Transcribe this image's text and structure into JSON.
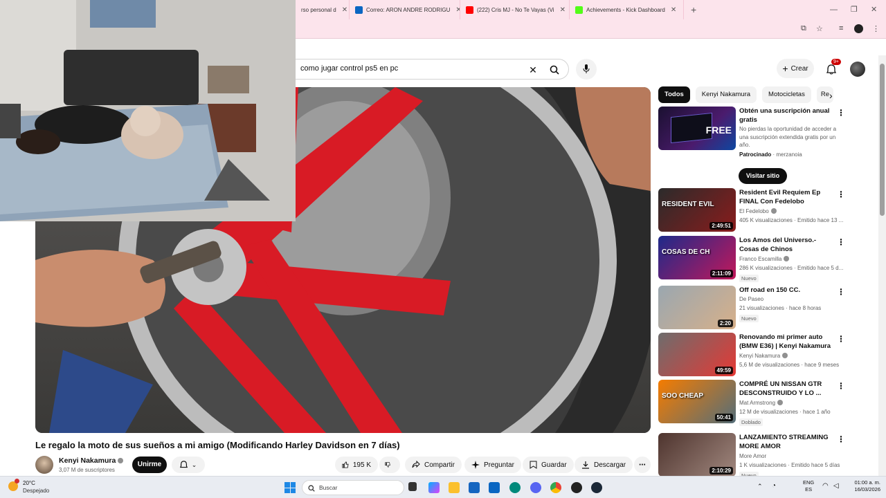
{
  "browser": {
    "tabs": [
      {
        "label": "rso personal d",
        "color": "#9e9e9e"
      },
      {
        "label": "Correo: ARON ANDRE RODRIGU",
        "color": "#0a66c2"
      },
      {
        "label": "(222) Cris MJ - No Te Vayas (Vi",
        "color": "#ff0000"
      },
      {
        "label": "Achievements - Kick Dashboard",
        "color": "#53fc18"
      }
    ]
  },
  "header": {
    "search_query": "como jugar control ps5 en pc",
    "create_label": "Crear",
    "notifications_count": "9+"
  },
  "video": {
    "title": "Le regalo la moto de sus sueños a mi amigo (Modificando Harley Davidson en 7 días)",
    "channel": "Kenyi Nakamura",
    "subscribers": "3,07 M de suscriptores",
    "join_label": "Unirme",
    "likes": "195 K",
    "share_label": "Compartir",
    "ask_label": "Preguntar",
    "save_label": "Guardar",
    "download_label": "Descargar"
  },
  "chips": [
    "Todos",
    "Kenyi Nakamura",
    "Motocicletas",
    "Re"
  ],
  "ad": {
    "title": "Obtén una suscripción anual gratis",
    "description": "No pierdas la oportunidad de acceder a una suscripción extendida gratis por un año.",
    "sponsored": "Patrocinado",
    "advertiser": "merzanoia",
    "cta": "Visitar sitio",
    "thumb_free": "FREE"
  },
  "recommendations": [
    {
      "title": "Resident Evil Requiem Ep FINAL Con Fedelobo",
      "channel": "El Fedelobo",
      "verified": true,
      "meta": "405 K visualizaciones · Emitido hace 13 ...",
      "duration": "2:49:51",
      "badge": "",
      "thumb_text": "RESIDENT EVIL",
      "colors": [
        "#2b2b2b",
        "#8a1c1c"
      ]
    },
    {
      "title": "Los Amos del Universo.- Cosas de Chinos",
      "channel": "Franco Escamilla",
      "verified": true,
      "meta": "286 K visualizaciones · Emitido hace 5 d...",
      "duration": "2:11:09",
      "badge": "Nuevo",
      "thumb_text": "COSAS DE CH",
      "colors": [
        "#1d2a8a",
        "#c2185b"
      ]
    },
    {
      "title": "Off road en 150 CC.",
      "channel": "De Paseo",
      "verified": false,
      "meta": "21 visualizaciones · hace 8 horas",
      "duration": "2:20",
      "badge": "Nuevo",
      "thumb_text": "",
      "colors": [
        "#9aa7b0",
        "#d7b08a"
      ]
    },
    {
      "title": "Renovando mi primer auto (BMW E36) | Kenyi Nakamura",
      "channel": "Kenyi Nakamura",
      "verified": true,
      "meta": "5,6 M de visualizaciones · hace 9 meses",
      "duration": "49:59",
      "badge": "",
      "thumb_text": "",
      "colors": [
        "#6d6d6d",
        "#e53935"
      ]
    },
    {
      "title": "COMPRÉ UN NISSAN GTR DESCONSTRUIDO Y LO ...",
      "channel": "Mat Armstrong",
      "verified": true,
      "meta": "12 M de visualizaciones · hace 1 año",
      "duration": "50:41",
      "badge": "Doblado",
      "thumb_text": "SOO CHEAP",
      "colors": [
        "#f57c00",
        "#546e7a"
      ]
    },
    {
      "title": "LANZAMIENTO STREAMING MORE AMOR",
      "channel": "More Amor",
      "verified": false,
      "meta": "1 K visualizaciones · Emitido hace 5 días",
      "duration": "2:10:29",
      "badge": "Nuevo",
      "thumb_text": "",
      "colors": [
        "#4e342e",
        "#a1887f"
      ]
    }
  ],
  "taskbar": {
    "weather_temp": "20°C",
    "weather_desc": "Despejado",
    "search_placeholder": "Buscar",
    "lang_top": "ENG",
    "lang_bottom": "ES",
    "time": "01:00 a. m.",
    "date": "16/03/2026"
  }
}
